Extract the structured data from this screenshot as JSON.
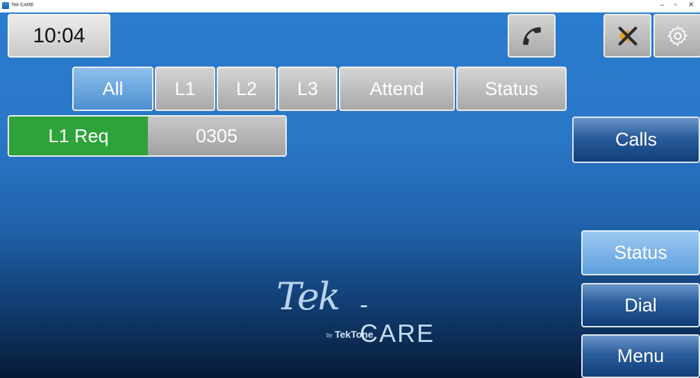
{
  "window": {
    "title": "Tek-CARE",
    "minimize": "–",
    "restore": "▫",
    "close": "✕"
  },
  "header": {
    "clock": "10:04",
    "phone_icon": "phone-handset-icon",
    "mute_icon": "speaker-muted-icon",
    "settings_icon": "gear-icon"
  },
  "filter_tabs": [
    {
      "label": "All",
      "active": true
    },
    {
      "label": "L1",
      "active": false
    },
    {
      "label": "L2",
      "active": false
    },
    {
      "label": "L3",
      "active": false
    },
    {
      "label": "Attend",
      "active": false
    },
    {
      "label": "Status",
      "active": false
    }
  ],
  "requests": [
    {
      "type": "L1 Req",
      "room": "0305",
      "color": "#2ea33a"
    }
  ],
  "side_buttons": {
    "calls": "Calls",
    "status": "Status",
    "dial": "Dial",
    "menu": "Menu"
  },
  "logo": {
    "script": "Tek",
    "dash_care": "-CARE",
    "by": "by",
    "brand": "TekTone"
  }
}
